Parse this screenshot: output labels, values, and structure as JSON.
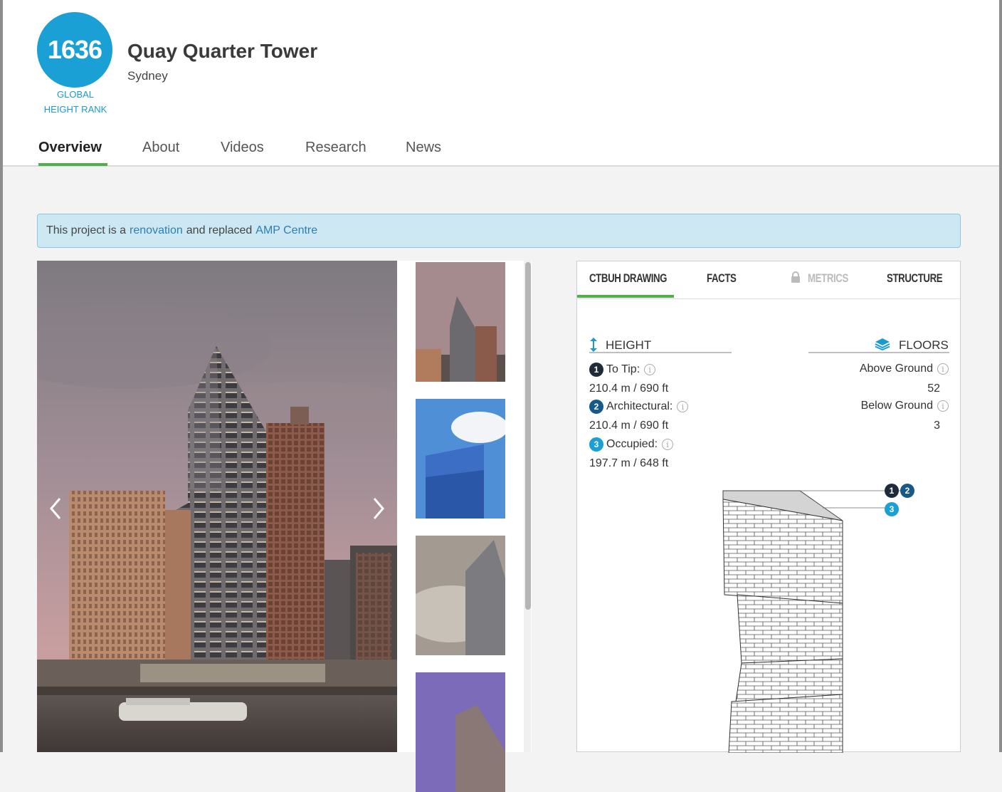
{
  "header": {
    "rank": {
      "number": "1636",
      "label_line1": "GLOBAL",
      "label_line2": "HEIGHT RANK"
    },
    "building_name": "Quay Quarter Tower",
    "city": "Sydney"
  },
  "tabs": [
    {
      "label": "Overview",
      "active": true
    },
    {
      "label": "About"
    },
    {
      "label": "Videos"
    },
    {
      "label": "Research"
    },
    {
      "label": "News"
    }
  ],
  "notice": {
    "text_before": "This project is a",
    "link1": "renovation",
    "text_middle": "and replaced",
    "link2": "AMP Centre"
  },
  "gallery": {
    "thumbnail_count": 4,
    "icons": [
      "chevron-left-icon",
      "chevron-right-icon"
    ]
  },
  "panel": {
    "tabs": [
      {
        "label": "CTBUH DRAWING",
        "active": true
      },
      {
        "label": "FACTS"
      },
      {
        "label": "METRICS",
        "locked": true
      },
      {
        "label": "STRUCTURE"
      }
    ],
    "height": {
      "title": "HEIGHT",
      "to_tip_label": "To Tip:",
      "to_tip_value": "210.4 m / 690 ft",
      "architectural_label": "Architectural:",
      "architectural_value": "210.4 m / 690 ft",
      "occupied_label": "Occupied:",
      "occupied_value": "197.7 m / 648 ft"
    },
    "floors": {
      "title": "FLOORS",
      "above_label": "Above Ground",
      "above_value": "52",
      "below_label": "Below Ground",
      "below_value": "3"
    },
    "markers": {
      "m1": "1",
      "m2": "2",
      "m3": "3"
    }
  },
  "colors": {
    "accent": "#1aa0d5",
    "active_tab": "#4db04a",
    "notice_bg": "#cde8f3"
  }
}
